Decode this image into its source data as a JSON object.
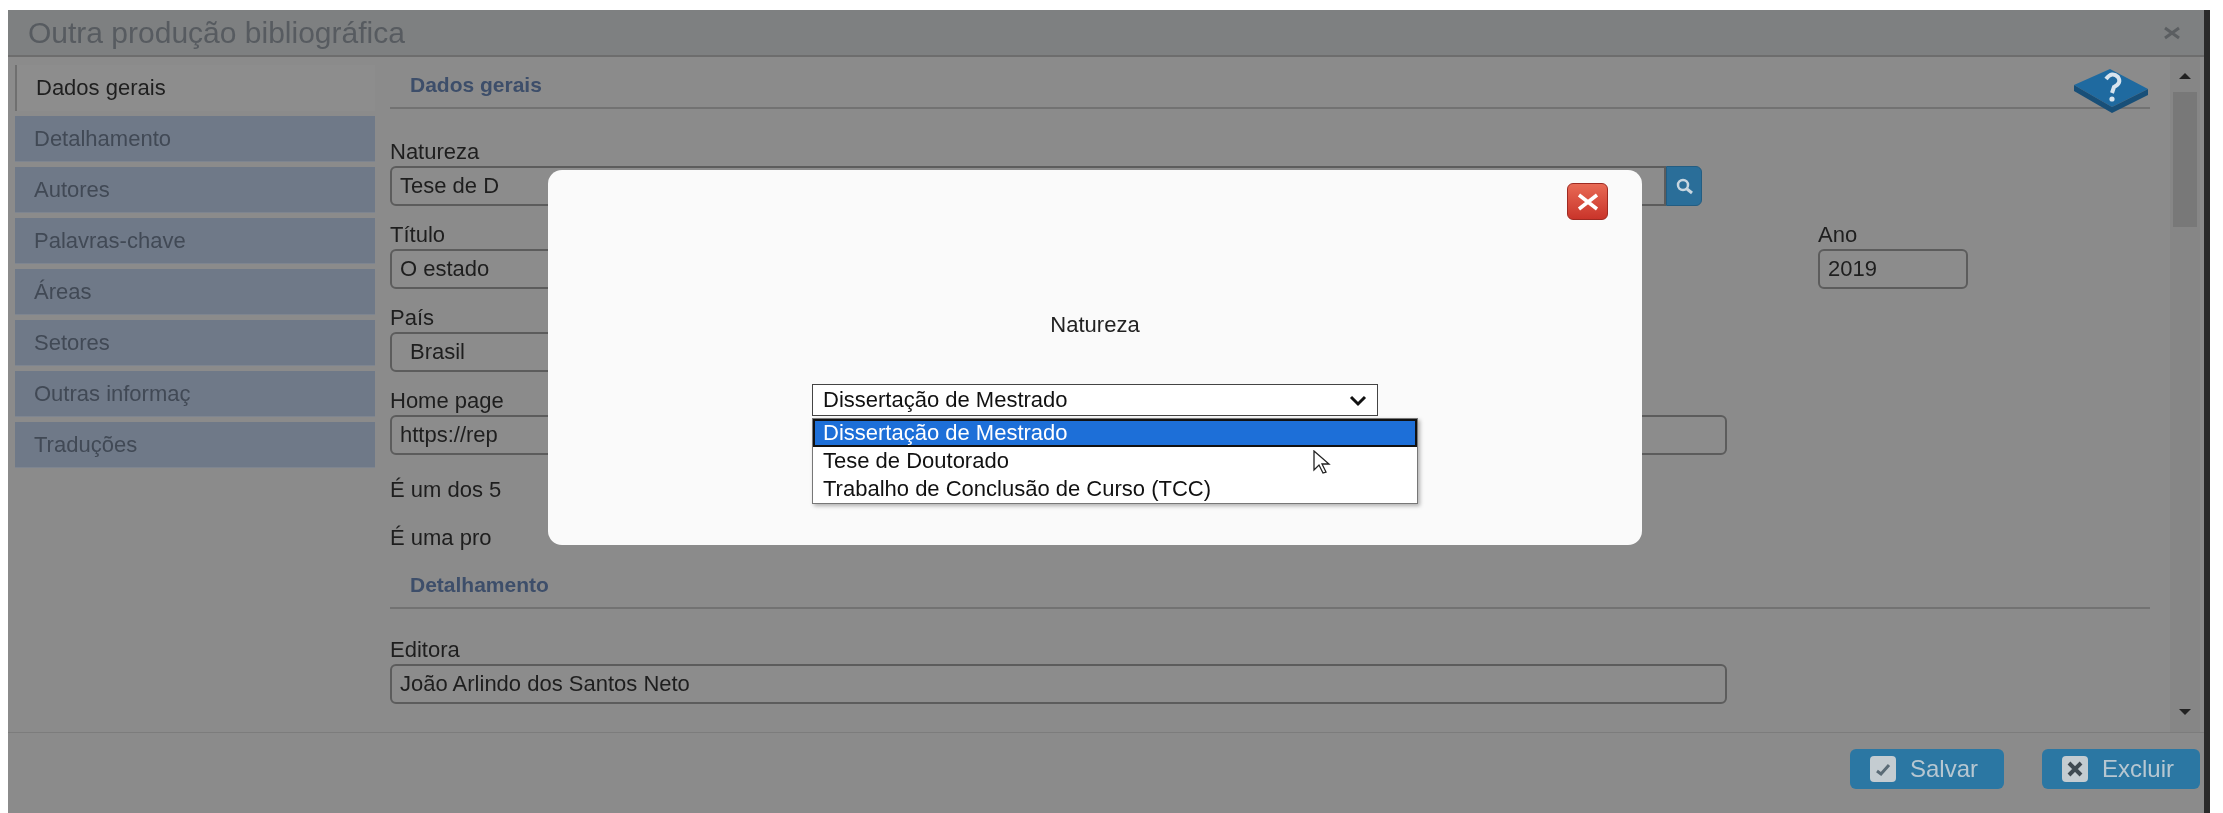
{
  "window": {
    "title": "Outra produção bibliográfica"
  },
  "sidebar": {
    "items": [
      {
        "label": "Dados gerais",
        "selected": true
      },
      {
        "label": "Detalhamento",
        "selected": false
      },
      {
        "label": "Autores",
        "selected": false
      },
      {
        "label": "Palavras-chave",
        "selected": false
      },
      {
        "label": "Áreas",
        "selected": false
      },
      {
        "label": "Setores",
        "selected": false
      },
      {
        "label": "Outras informaç",
        "selected": false
      },
      {
        "label": "Traduções",
        "selected": false
      }
    ]
  },
  "general": {
    "heading": "Dados gerais",
    "natureza": {
      "label": "Natureza",
      "value": "Tese de D"
    },
    "titulo": {
      "label": "Título",
      "value": "O estado"
    },
    "ano": {
      "label": "Ano",
      "value": "2019"
    },
    "pais": {
      "label": "País",
      "value": "Brasil"
    },
    "home_page": {
      "label": "Home page",
      "value": "https://rep"
    },
    "questions": [
      "É um dos 5",
      "É uma pro"
    ]
  },
  "details": {
    "heading": "Detalhamento",
    "editora": {
      "label": "Editora",
      "value": "João Arlindo dos Santos Neto"
    }
  },
  "buttons": [
    {
      "label": "Salvar",
      "kind": "save"
    },
    {
      "label": "Excluir",
      "kind": "delete"
    }
  ],
  "modal": {
    "label": "Natureza",
    "select": {
      "value": "Dissertação de Mestrado",
      "expanded": true
    },
    "options": [
      {
        "label": "Dissertação de Mestrado",
        "selected": true
      },
      {
        "label": "Tese de Doutorado",
        "selected": false
      },
      {
        "label": "Trabalho de Conclusão de Curso (TCC)",
        "selected": false
      }
    ]
  }
}
